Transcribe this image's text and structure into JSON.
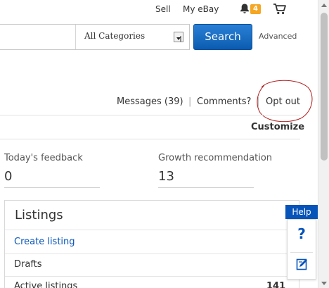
{
  "header": {
    "sell_label": "Sell",
    "my_ebay_label": "My eBay",
    "notification_count": "4",
    "bell_icon": "bell-icon",
    "cart_icon": "cart-icon"
  },
  "search": {
    "input_value": "",
    "category_selected": "All Categories",
    "button_label": "Search",
    "advanced_label": "Advanced"
  },
  "messages_bar": {
    "messages_label": "Messages (39)",
    "separator": "|",
    "comments_label": "Comments?",
    "opt_out_label": "Opt out",
    "annotation_color": "#b22222"
  },
  "customize_label": "Customize",
  "stats": {
    "todays_feedback": {
      "label": "Today's feedback",
      "value": "0"
    },
    "growth_recommendation": {
      "label": "Growth recommendation",
      "value": "13"
    }
  },
  "listings": {
    "title": "Listings",
    "items": [
      {
        "label": "Create listing",
        "count": ""
      },
      {
        "label": "Drafts",
        "count": ""
      },
      {
        "label": "Active listings",
        "count": "141"
      }
    ]
  },
  "help_widget": {
    "tab_label": "Help",
    "question_glyph": "?",
    "question_icon": "question-icon",
    "feedback_icon": "feedback-icon"
  },
  "colors": {
    "accent_blue": "#0654ba",
    "search_button": "#1a6dc5",
    "badge": "#f5a623"
  }
}
